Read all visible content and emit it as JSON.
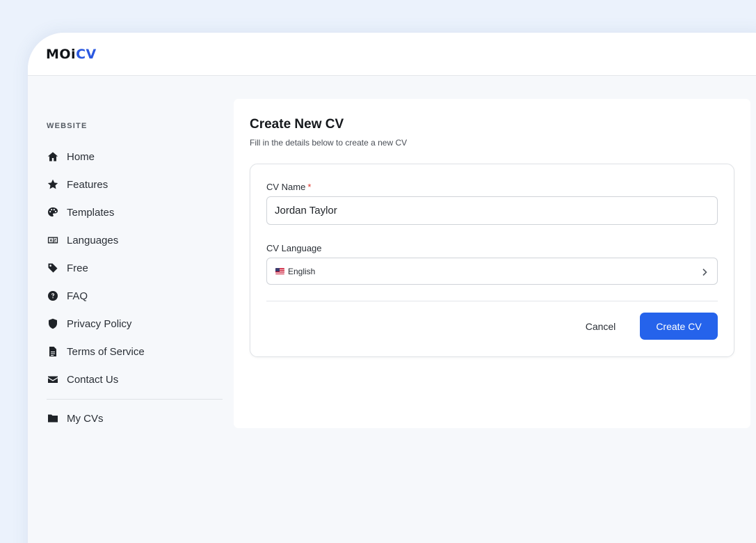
{
  "app": {
    "logo_part1": "MOi",
    "logo_part2": "CV",
    "brand_color": "#2b59e0"
  },
  "sidebar": {
    "section_title": "WEBSITE",
    "items": [
      {
        "label": "Home",
        "icon": "home-icon"
      },
      {
        "label": "Features",
        "icon": "star-icon"
      },
      {
        "label": "Templates",
        "icon": "palette-icon"
      },
      {
        "label": "Languages",
        "icon": "language-icon"
      },
      {
        "label": "Free",
        "icon": "tag-icon"
      },
      {
        "label": "FAQ",
        "icon": "question-icon"
      },
      {
        "label": "Privacy Policy",
        "icon": "shield-icon"
      },
      {
        "label": "Terms of Service",
        "icon": "document-icon"
      },
      {
        "label": "Contact Us",
        "icon": "envelope-icon"
      }
    ],
    "my_cvs": {
      "label": "My CVs",
      "icon": "folder-icon"
    }
  },
  "form": {
    "title": "Create New CV",
    "subtitle": "Fill in the details below to create a new CV",
    "cv_name_label": "CV Name",
    "required_mark": "*",
    "cv_name_value": "Jordan Taylor",
    "cv_language_label": "CV Language",
    "cv_language_value": "English",
    "cancel_label": "Cancel",
    "create_label": "Create CV",
    "primary_color": "#2563eb"
  }
}
